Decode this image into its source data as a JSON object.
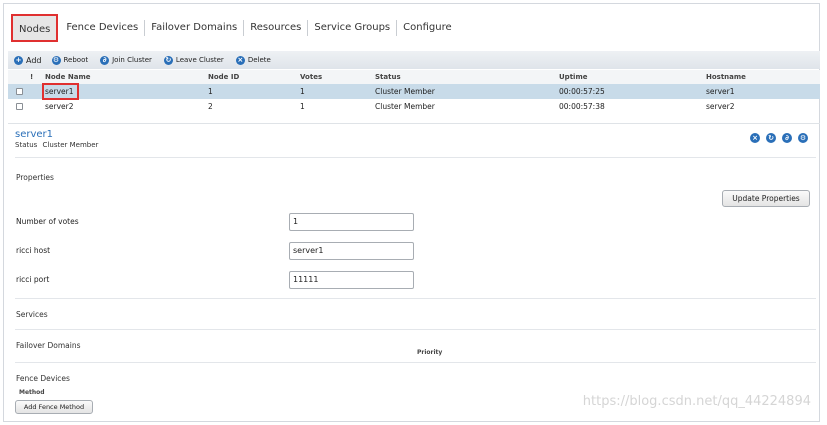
{
  "tabs": [
    {
      "label": "Nodes"
    },
    {
      "label": "Fence Devices"
    },
    {
      "label": "Failover Domains"
    },
    {
      "label": "Resources"
    },
    {
      "label": "Service Groups"
    },
    {
      "label": "Configure"
    }
  ],
  "toolbar": {
    "add": "Add",
    "reboot": "Reboot",
    "join": "Join Cluster",
    "leave": "Leave Cluster",
    "delete": "Delete"
  },
  "table": {
    "columns": [
      "!",
      "Node Name",
      "Node ID",
      "Votes",
      "Status",
      "Uptime",
      "Hostname"
    ],
    "rows": [
      {
        "name": "server1",
        "id": "1",
        "votes": "1",
        "status": "Cluster Member",
        "uptime": "00:00:57:25",
        "hostname": "server1"
      },
      {
        "name": "server2",
        "id": "2",
        "votes": "1",
        "status": "Cluster Member",
        "uptime": "00:00:57:38",
        "hostname": "server2"
      }
    ]
  },
  "detail": {
    "title": "server1",
    "status_label": "Status",
    "status_value": "Cluster Member",
    "properties_title": "Properties",
    "update_button": "Update Properties",
    "fields": [
      {
        "label": "Number of votes",
        "value": "1"
      },
      {
        "label": "ricci host",
        "value": "server1"
      },
      {
        "label": "ricci port",
        "value": "11111"
      }
    ],
    "services_title": "Services",
    "failover_title": "Failover Domains",
    "priority_header": "Priority",
    "fence_title": "Fence Devices",
    "method_header": "Method",
    "add_method_button": "Add Fence Method"
  },
  "watermark": "https://blog.csdn.net/qq_44224894",
  "colors": {
    "accent": "#2a6fb8",
    "selected_row": "#c8dbe9",
    "highlight": "#e03030"
  }
}
